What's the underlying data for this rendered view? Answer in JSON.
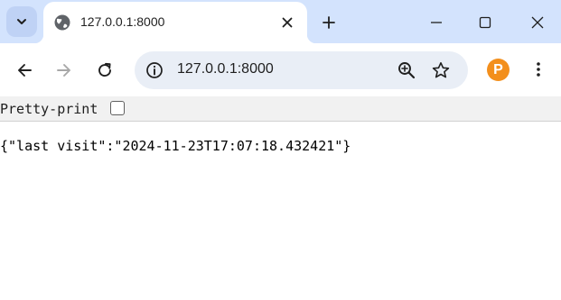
{
  "tab": {
    "title": "127.0.0.1:8000"
  },
  "omnibox": {
    "url": "127.0.0.1:8000"
  },
  "profile": {
    "letter": "P"
  },
  "viewer": {
    "pretty_print_label": "Pretty-print",
    "pretty_print_checked": false
  },
  "content": {
    "json_text": "{\"last visit\":\"2024-11-23T17:07:18.432421\"}"
  },
  "colors": {
    "tabstrip": "#d3e3fd",
    "omnibox": "#e9eef6",
    "profile": "#f38f1c"
  },
  "icons": [
    "chevron-down-icon",
    "globe-icon",
    "close-icon",
    "plus-icon",
    "minimize-icon",
    "maximize-icon",
    "window-close-icon",
    "back-arrow-icon",
    "forward-arrow-icon",
    "reload-icon",
    "info-icon",
    "zoom-icon",
    "star-icon",
    "kebab-menu-icon"
  ]
}
